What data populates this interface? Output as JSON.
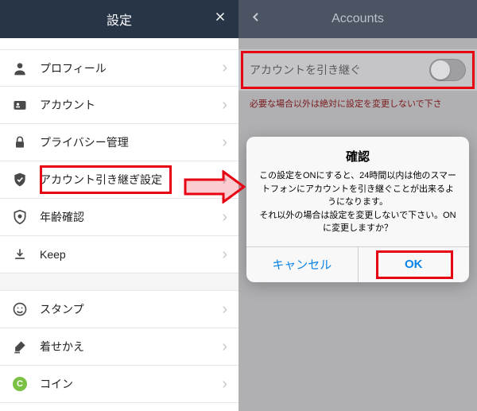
{
  "left": {
    "title": "設定",
    "items_group1": [
      {
        "label": "プロフィール",
        "icon": "person"
      },
      {
        "label": "アカウント",
        "icon": "id-card"
      },
      {
        "label": "プライバシー管理",
        "icon": "lock"
      },
      {
        "label": "アカウント引き継ぎ設定",
        "icon": "shield-check",
        "highlight": true
      },
      {
        "label": "年齢確認",
        "icon": "shield-badge"
      },
      {
        "label": "Keep",
        "icon": "download"
      }
    ],
    "items_group2": [
      {
        "label": "スタンプ",
        "icon": "smiley"
      },
      {
        "label": "着せかえ",
        "icon": "brush"
      },
      {
        "label": "コイン",
        "icon": "coin"
      }
    ]
  },
  "right": {
    "title": "Accounts",
    "toggle_label": "アカウントを引き継ぐ",
    "warning": "必要な場合以外は絶対に設定を変更しないで下さ",
    "dialog": {
      "title": "確認",
      "body": "この設定をONにすると、24時間以内は他のスマートフォンにアカウントを引き継ぐことが出来るようになります。\nそれ以外の場合は設定を変更しないで下さい。ONに変更しますか？",
      "cancel": "キャンセル",
      "ok": "OK"
    }
  }
}
